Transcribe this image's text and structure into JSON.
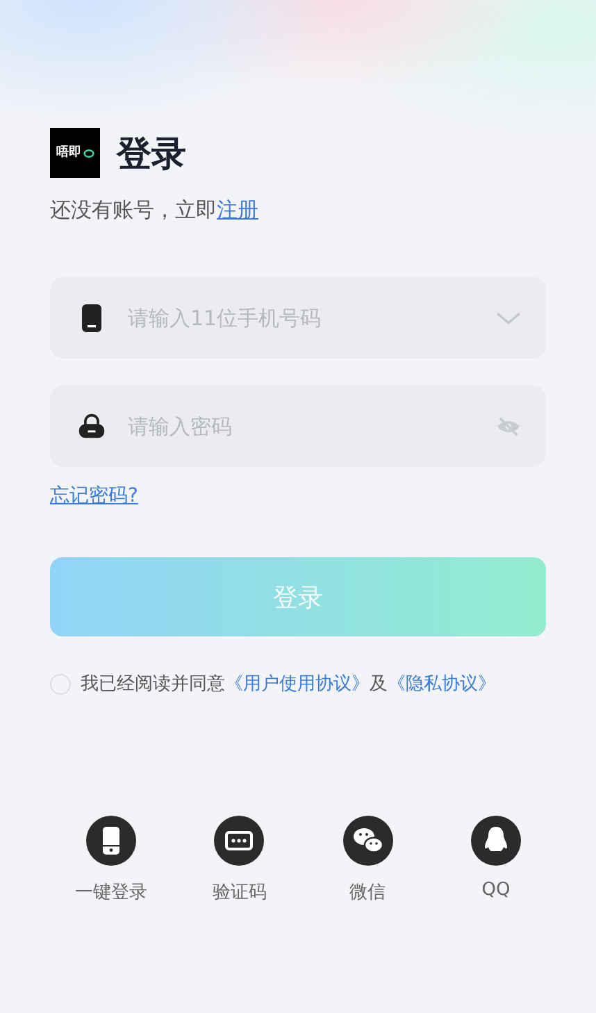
{
  "logo": {
    "text": "唔即"
  },
  "title": "登录",
  "subtitle": {
    "text": "还没有账号，立即",
    "link": "注册"
  },
  "fields": [
    {
      "kind": "phone",
      "placeholder": "请输入11位手机号码"
    },
    {
      "kind": "password",
      "placeholder": "请输入密码"
    }
  ],
  "forgot_link": "忘记密码?",
  "login_button": {
    "label": "登录",
    "disabled": true
  },
  "agreement": {
    "checked": false,
    "text": "我已经阅读并同意",
    "link1": "《用户使用协议》",
    "joiner": "及",
    "link2": "《隐私协议》"
  },
  "other_logins": [
    {
      "kind": "phone",
      "label": "一键登录"
    },
    {
      "kind": "sms",
      "label": "验证码"
    },
    {
      "kind": "wechat",
      "label": "微信"
    },
    {
      "kind": "qq",
      "label": "QQ"
    }
  ]
}
